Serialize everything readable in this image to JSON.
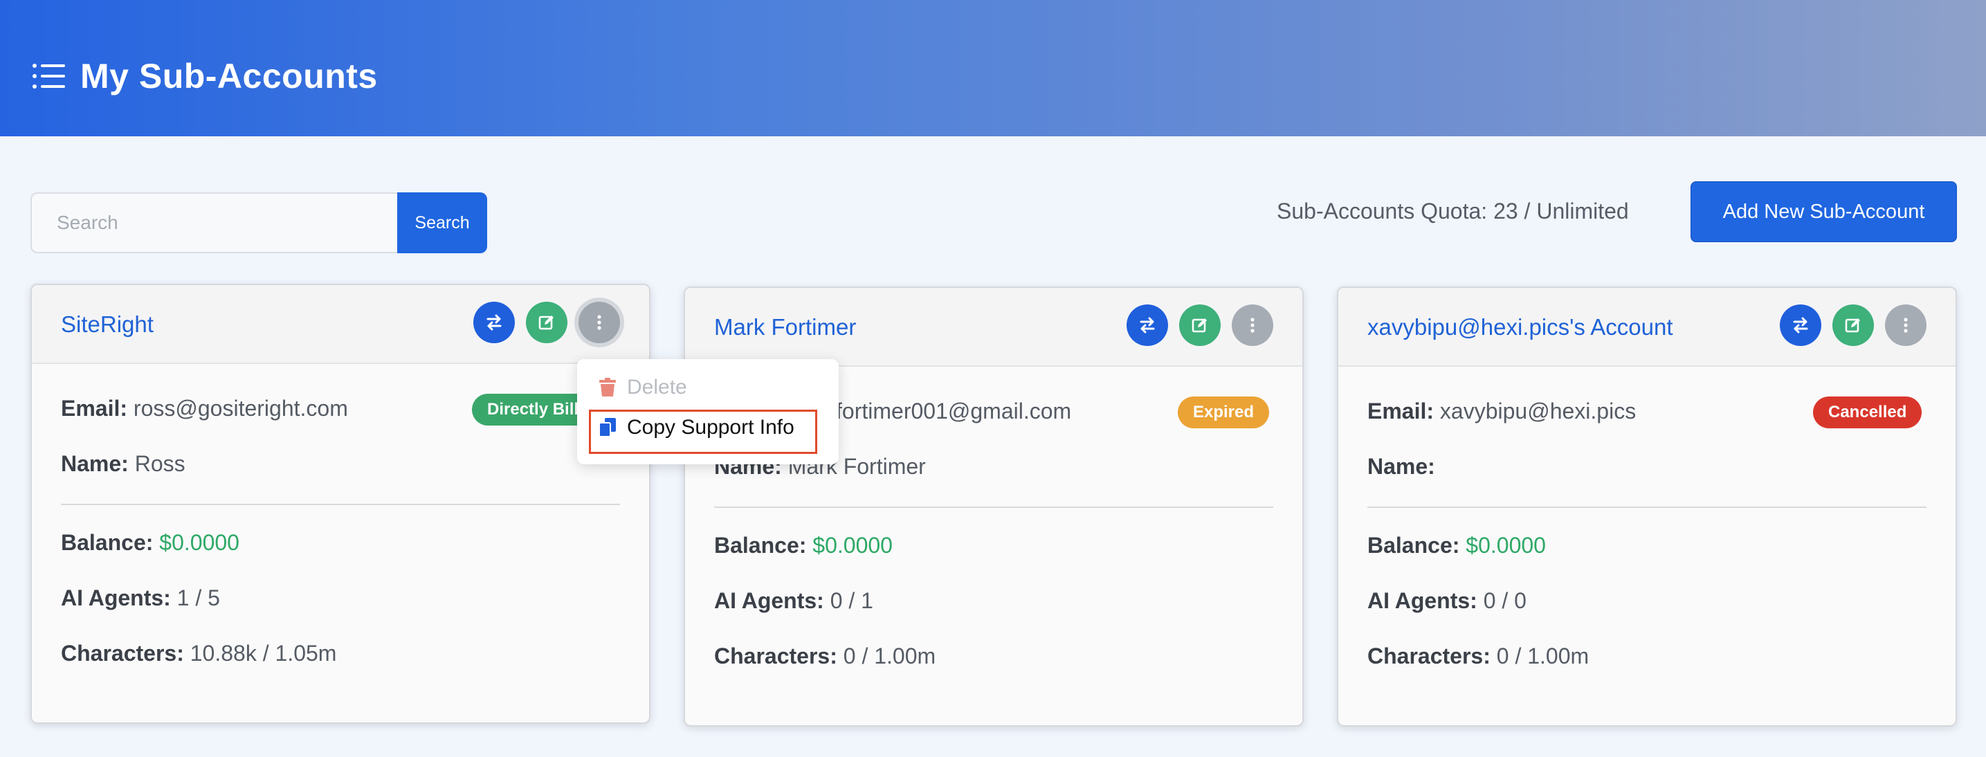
{
  "header": {
    "title": "My Sub-Accounts",
    "icon": "list-icon"
  },
  "search": {
    "placeholder": "Search",
    "value": "",
    "button_label": "Search"
  },
  "quota": {
    "text": "Sub-Accounts Quota: 23 / Unlimited"
  },
  "add_button": {
    "label": "Add New Sub-Account"
  },
  "labels": {
    "email": "Email:",
    "name": "Name:",
    "balance": "Balance:",
    "ai_agents": "AI Agents:",
    "characters": "Characters:"
  },
  "cards": [
    {
      "title": "SiteRight",
      "email": "ross@gositeright.com",
      "name": "Ross",
      "status": "Directly Billed",
      "status_color": "#3aa76a",
      "balance": "$0.0000",
      "ai_agents": "1 / 5",
      "characters": "10.88k / 1.05m"
    },
    {
      "title": "Mark Fortimer",
      "email": "markfortimer001@gmail.com",
      "name": "Mark Fortimer",
      "status": "Expired",
      "status_color": "#eba335",
      "balance": "$0.0000",
      "ai_agents": "0 / 1",
      "characters": "0 / 1.00m"
    },
    {
      "title": "xavybipu@hexi.pics's Account",
      "email": "xavybipu@hexi.pics",
      "name": "",
      "status": "Cancelled",
      "status_color": "#d9362b",
      "balance": "$0.0000",
      "ai_agents": "0 / 0",
      "characters": "0 / 1.00m"
    }
  ],
  "dropdown": {
    "items": [
      {
        "label": "Delete",
        "icon": "trash-icon",
        "disabled": true
      },
      {
        "label": "Copy Support Info",
        "icon": "copy-icon",
        "highlighted": true
      }
    ]
  },
  "colors": {
    "accent": "#1f66e0",
    "title_link": "#1f62d6",
    "balance": "#2ea866"
  }
}
